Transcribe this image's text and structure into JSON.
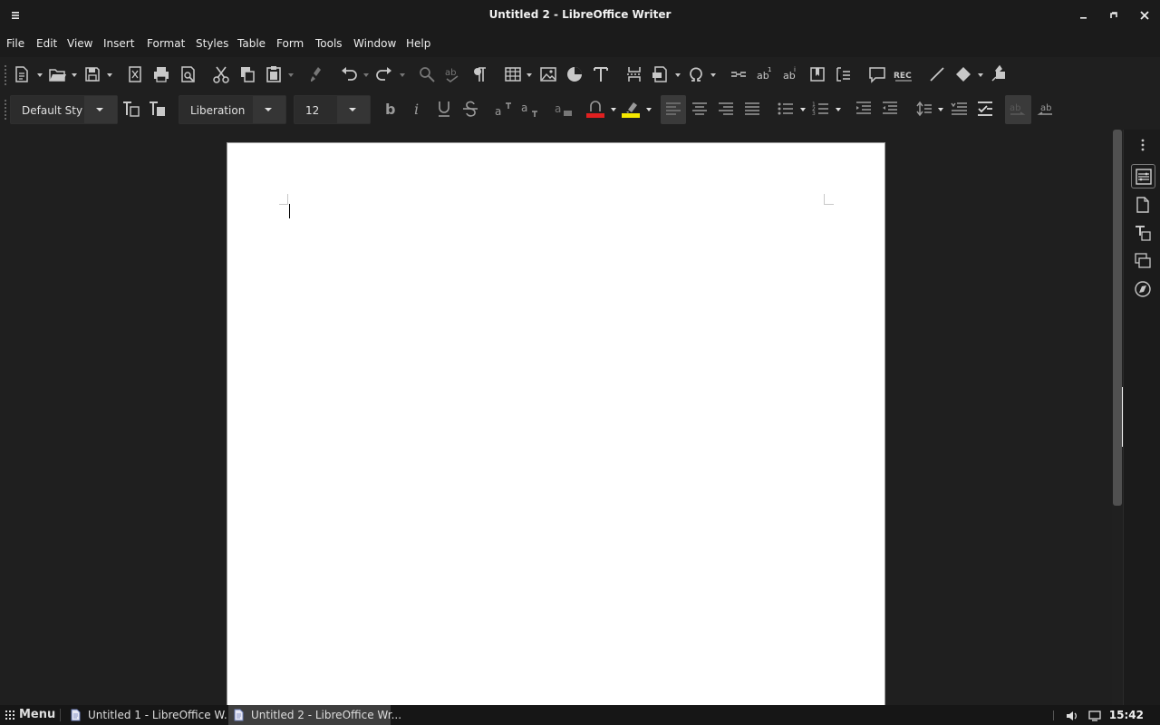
{
  "window": {
    "title": "Untitled 2 - LibreOffice Writer"
  },
  "menu": [
    "File",
    "Edit",
    "View",
    "Insert",
    "Format",
    "Styles",
    "Table",
    "Form",
    "Tools",
    "Window",
    "Help"
  ],
  "formatting": {
    "paragraph_style": "Default Sty",
    "font_name": "Liberation",
    "font_size": "12"
  },
  "colors": {
    "font_color": "#e02020",
    "highlight_color": "#f5e800"
  },
  "taskbar": {
    "menu_label": "Menu",
    "tasks": [
      "Untitled 1 - LibreOffice W...",
      "Untitled 2 - LibreOffice Wr..."
    ],
    "clock": "15:42"
  }
}
